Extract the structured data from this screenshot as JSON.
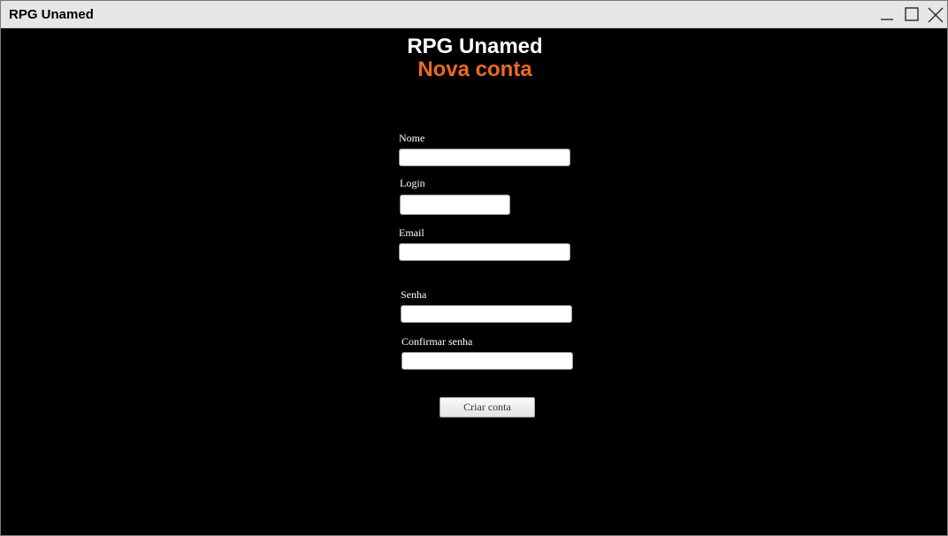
{
  "window": {
    "title": "RPG Unamed",
    "controls": [
      "minimize-icon",
      "maximize-icon",
      "close-icon"
    ]
  },
  "header": {
    "title": "RPG Unamed",
    "subtitle": "Nova conta",
    "subtitle_color": "#ee6a18"
  },
  "form": {
    "nome": {
      "label": "Nome",
      "value": ""
    },
    "login": {
      "label": "Login",
      "value": ""
    },
    "email": {
      "label": "Email",
      "value": ""
    },
    "senha": {
      "label": "Senha",
      "value": ""
    },
    "confirmar": {
      "label": "Confirmar senha",
      "value": ""
    },
    "submit_label": "Criar conta"
  }
}
